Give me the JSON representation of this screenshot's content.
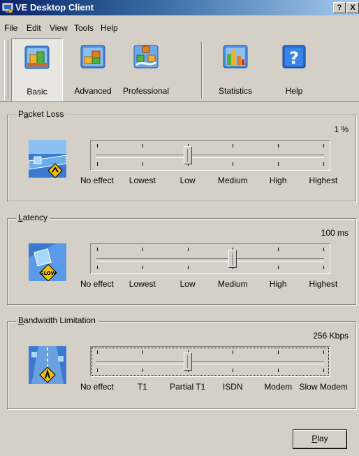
{
  "window": {
    "title": "VE Desktop Client",
    "help_button": "?",
    "close_button": "X"
  },
  "menu": [
    {
      "label": "File"
    },
    {
      "label": "Edit"
    },
    {
      "label": "View"
    },
    {
      "label": "Tools"
    },
    {
      "label": "Help"
    }
  ],
  "toolbar": {
    "buttons": [
      {
        "label": "Basic",
        "icon": "basic-icon",
        "active": true
      },
      {
        "label": "Advanced",
        "icon": "advanced-icon",
        "active": false
      },
      {
        "label": "Professional",
        "icon": "professional-icon",
        "active": false
      },
      {
        "label": "Statistics",
        "icon": "statistics-icon",
        "active": false
      },
      {
        "label": "Help",
        "icon": "help-icon",
        "active": false
      }
    ]
  },
  "packet_loss": {
    "title_pre": "P",
    "title_u": "a",
    "title_post": "cket Loss",
    "value": "1 %",
    "icon": "packet-loss-icon",
    "position": 2,
    "stops": [
      "No effect",
      "Lowest",
      "Low",
      "Medium",
      "High",
      "Highest"
    ]
  },
  "latency": {
    "title_pre": "",
    "title_u": "L",
    "title_post": "atency",
    "value": "100 ms",
    "icon": "latency-slow-icon",
    "position": 3,
    "stops": [
      "No effect",
      "Lowest",
      "Low",
      "Medium",
      "High",
      "Highest"
    ]
  },
  "bandwidth": {
    "title_pre": "",
    "title_u": "B",
    "title_post": "andwidth Limitation",
    "value": "256 Kbps",
    "icon": "bandwidth-icon",
    "position": 2,
    "stops": [
      "No effect",
      "T1",
      "Partial T1",
      "ISDN",
      "Modem",
      "Slow Modem"
    ]
  },
  "actions": {
    "play_u": "P",
    "play_rest": "lay"
  },
  "colors": {
    "titlebar_start": "#0a246a",
    "titlebar_end": "#a6caf0",
    "face": "#d4d0c8"
  }
}
